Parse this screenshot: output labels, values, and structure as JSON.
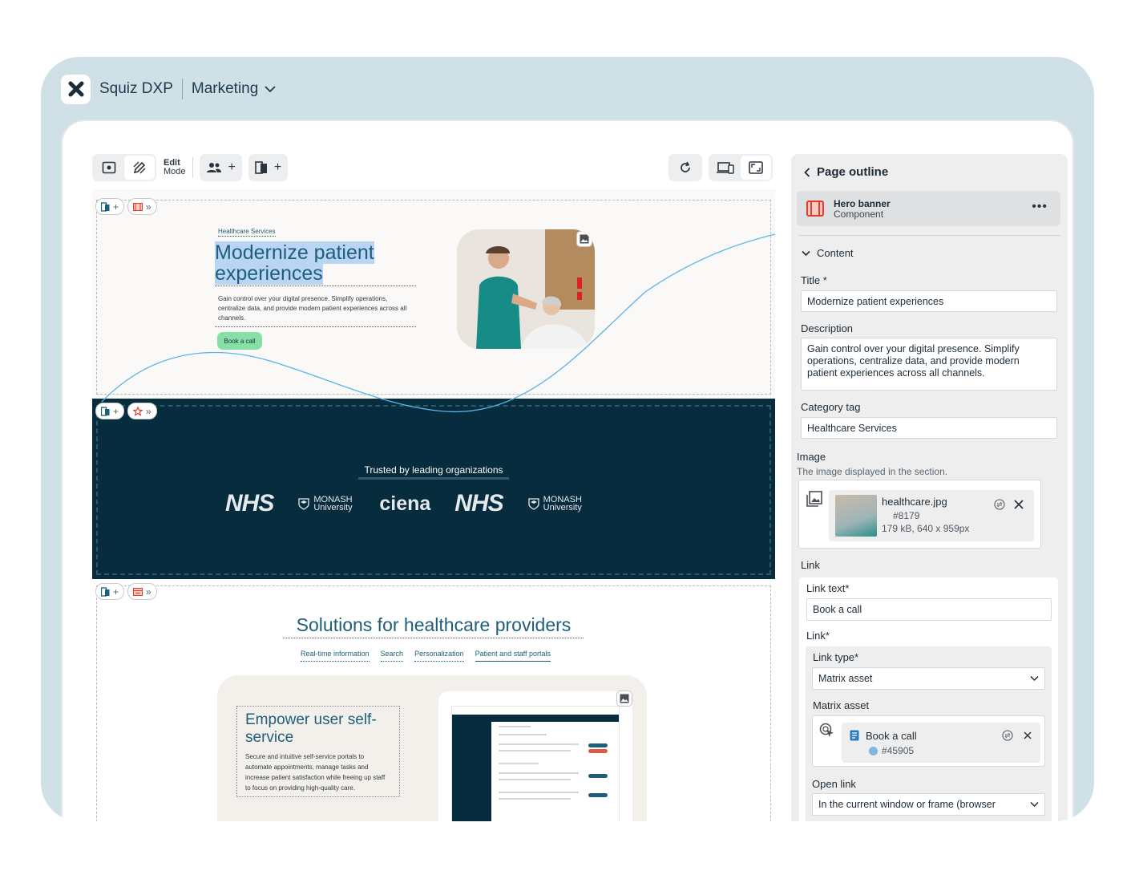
{
  "app": {
    "brand": "Squiz DXP",
    "workspace": "Marketing"
  },
  "toolbar": {
    "edit_label": "Edit",
    "mode_label": "Mode"
  },
  "hero": {
    "category": "Healthcare Services",
    "title": "Modernize patient experiences",
    "description": "Gain control over your digital presence. Simplify operations, centralize data, and provide modern patient experiences across all channels.",
    "button": "Book a call"
  },
  "trusted": {
    "heading": "Trusted by leading organizations",
    "logos": [
      "NHS",
      "MONASH University",
      "ciena",
      "NHS",
      "MONASH University"
    ]
  },
  "solutions": {
    "title": "Solutions for healthcare providers",
    "tabs": [
      "Real-time information",
      "Search",
      "Personalization",
      "Patient and staff portals"
    ],
    "card_title": "Empower user self-service",
    "card_desc": "Secure and intuitive self-service portals to automate appointments, manage tasks and increase patient satisfaction while freeing up staff to focus on providing high-quality care."
  },
  "panel": {
    "heading": "Page outline",
    "component_title": "Hero banner",
    "component_type": "Component",
    "content_label": "Content",
    "title_label": "Title *",
    "title_value": "Modernize patient experiences",
    "desc_label": "Description",
    "desc_value": "Gain control over your digital presence. Simplify operations, centralize data, and provide modern patient experiences across all channels.",
    "category_label": "Category tag",
    "category_value": "Healthcare Services",
    "image_label": "Image",
    "image_hint": "The image displayed in the section.",
    "image_file": "healthcare.jpg",
    "image_id": "#8179",
    "image_meta": "179 kB, 640 x 959px",
    "link_label": "Link",
    "link_text_label": "Link text*",
    "link_text_value": "Book a call",
    "link_star_label": "Link*",
    "link_type_label": "Link type*",
    "link_type_value": "Matrix asset",
    "matrix_label": "Matrix asset",
    "matrix_name": "Book a call",
    "matrix_id": "#45905",
    "open_label": "Open link",
    "open_value": "In the current window or frame (browser"
  },
  "colors": {
    "accent": "#1d5f7a",
    "dark_band": "#062c3d",
    "cta": "#86e0a6",
    "frame": "#cfe0e6"
  }
}
